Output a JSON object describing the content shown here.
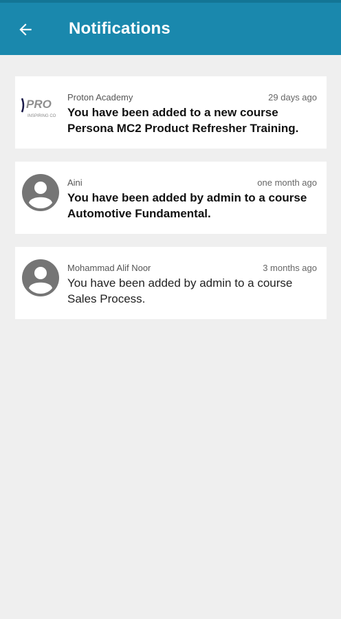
{
  "header": {
    "title": "Notifications",
    "back_icon": "arrow-left-icon"
  },
  "colors": {
    "app_bar": "#1a88ad",
    "background": "#efefef",
    "avatar": "#757575"
  },
  "notifications": [
    {
      "sender": "Proton Academy",
      "time": "29 days ago",
      "message": "You have been added to a new course Persona MC2 Product Refresher Training.",
      "icon": "proton-logo",
      "logo_text": "PRO",
      "logo_tagline": "INSPIRING CO",
      "unread": true
    },
    {
      "sender": "Aini",
      "time": "one month ago",
      "message": "You have been added by admin to a course Automotive Fundamental.",
      "icon": "user-avatar-icon",
      "unread": true
    },
    {
      "sender": "Mohammad Alif Noor",
      "time": "3 months ago",
      "message": "You have been added by admin to a course Sales Process.",
      "icon": "user-avatar-icon",
      "unread": false
    }
  ]
}
